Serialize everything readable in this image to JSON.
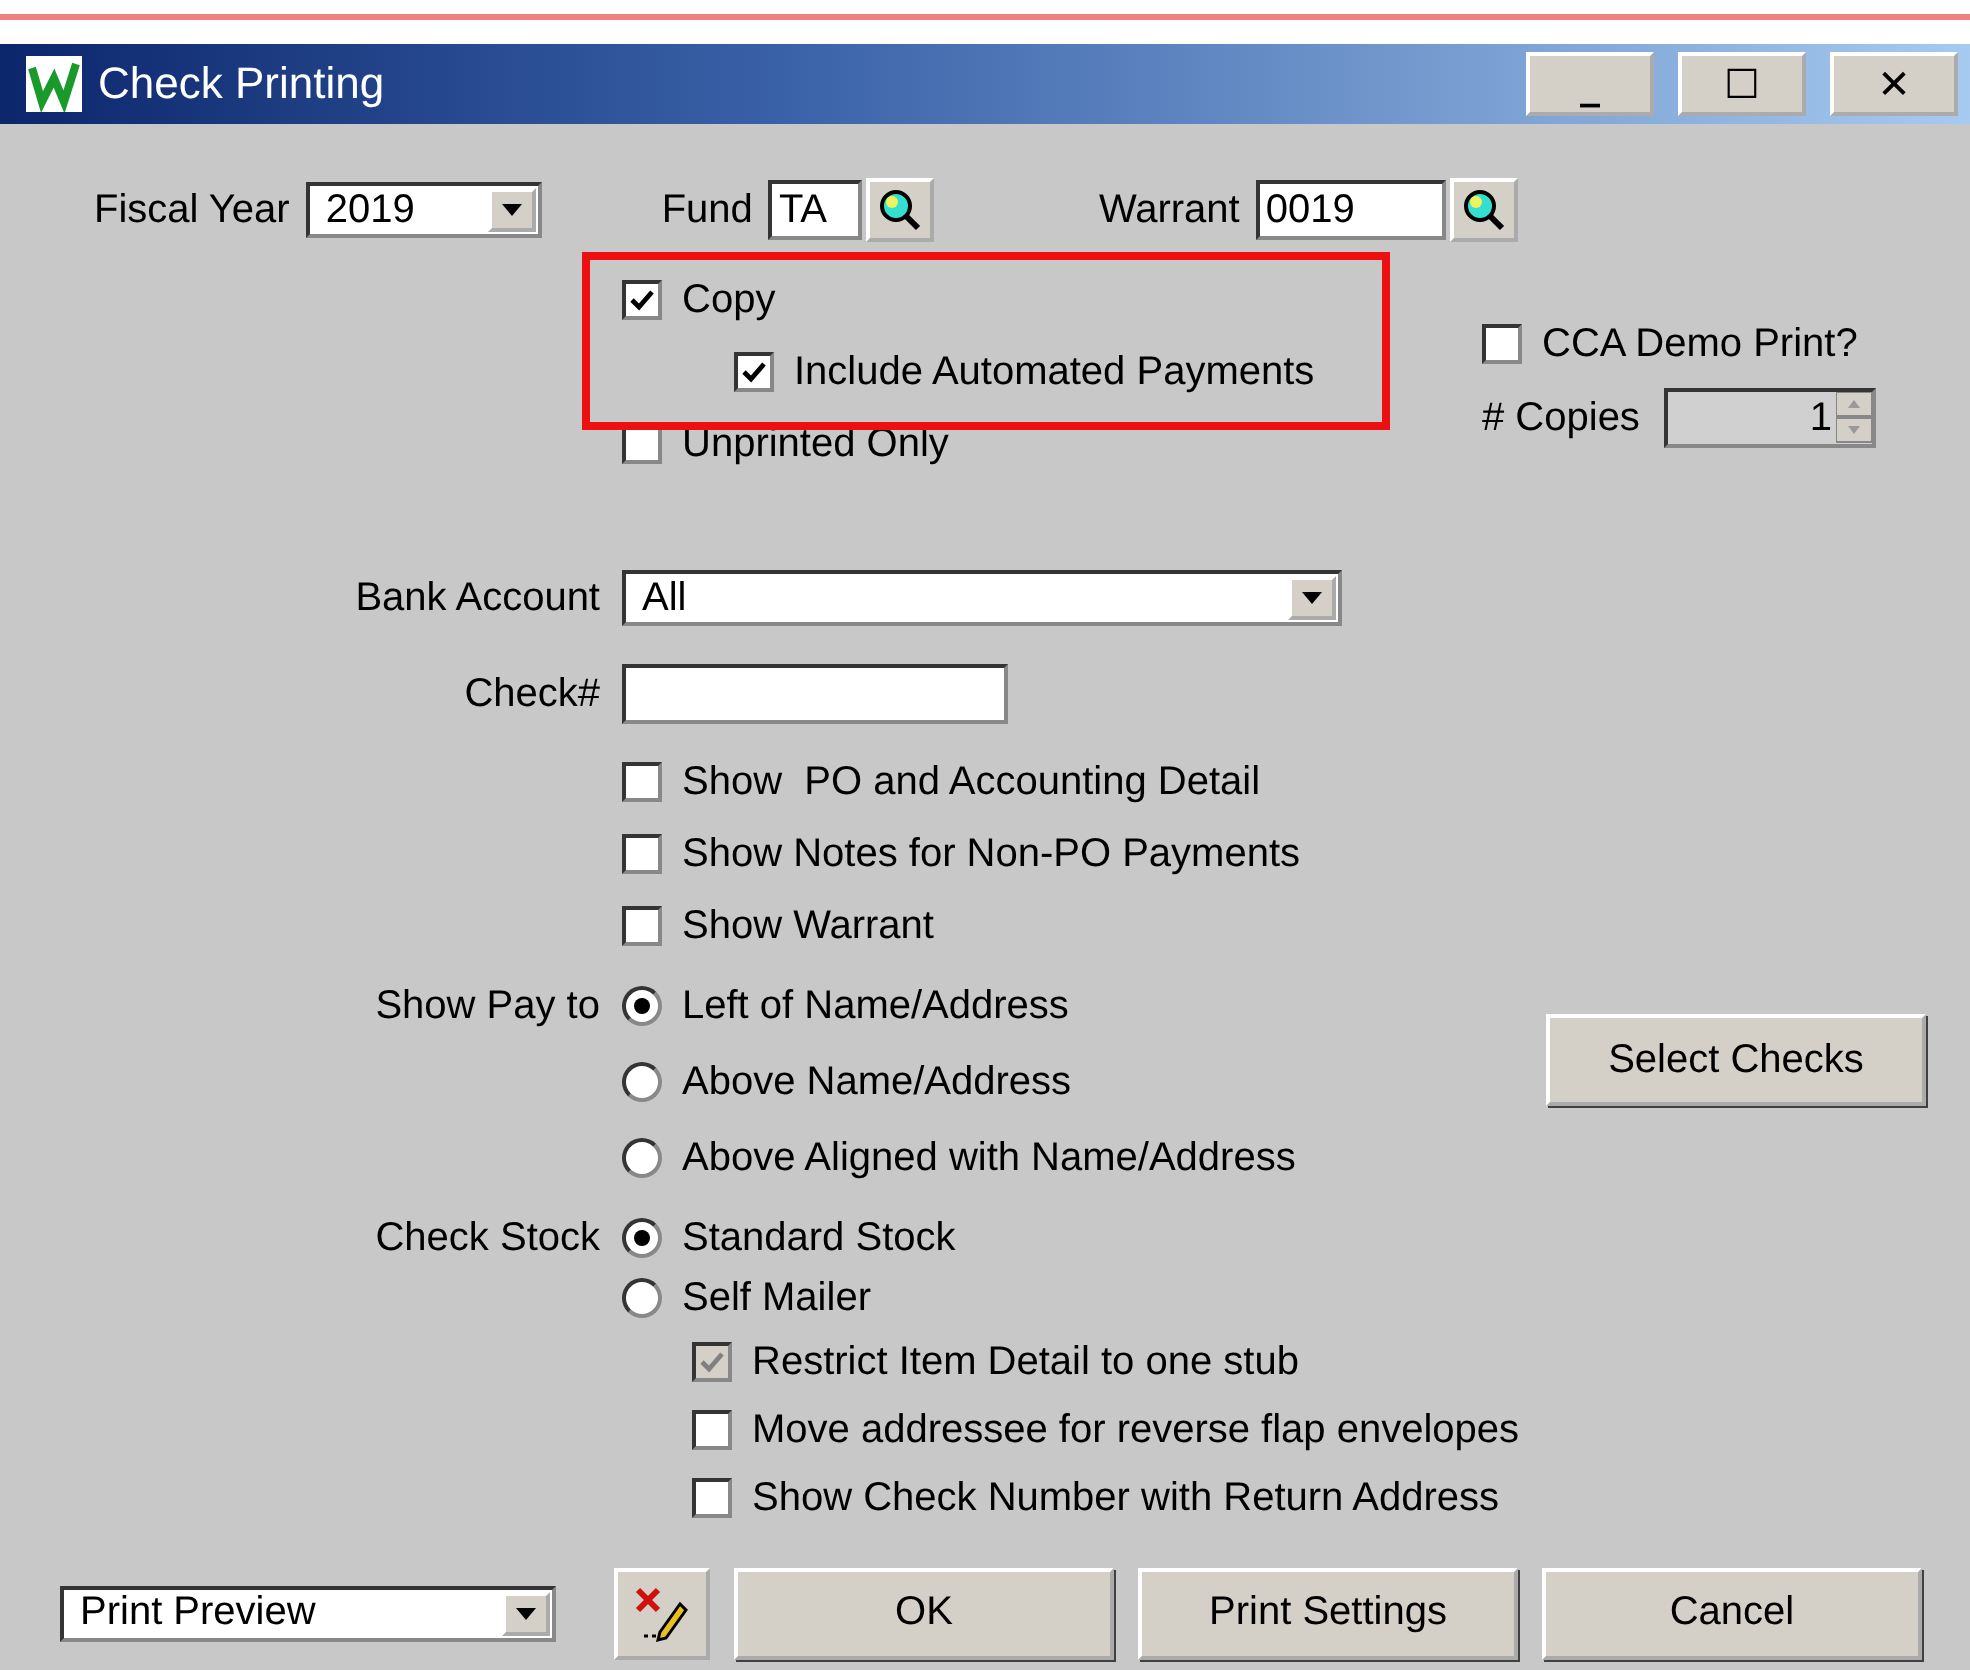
{
  "window": {
    "title": "Check Printing",
    "controls": [
      "_",
      "☐",
      "✕"
    ]
  },
  "fiscal_year": {
    "label": "Fiscal Year",
    "value": "2019"
  },
  "fund": {
    "label": "Fund",
    "value": "TA"
  },
  "warrant": {
    "label": "Warrant",
    "value": "0019"
  },
  "copy": {
    "label": "Copy",
    "checked": true
  },
  "include_automated": {
    "label": "Include Automated Payments",
    "checked": true
  },
  "unprinted_only": {
    "label": "Unprinted Only",
    "checked": false
  },
  "cca_demo": {
    "label": "CCA Demo Print?",
    "checked": false
  },
  "copies": {
    "label": "# Copies",
    "value": "1"
  },
  "bank_account": {
    "label": "Bank Account",
    "value": "All"
  },
  "check_number": {
    "label": "Check#"
  },
  "show_options": [
    {
      "label": "Show  PO and Accounting Detail",
      "checked": false
    },
    {
      "label": "Show Notes for Non-PO Payments",
      "checked": false
    },
    {
      "label": "Show Warrant",
      "checked": false
    }
  ],
  "show_pay_to": {
    "label": "Show Pay to",
    "options": [
      {
        "label": "Left of Name/Address",
        "selected": true
      },
      {
        "label": "Above Name/Address",
        "selected": false
      },
      {
        "label": "Above Aligned with Name/Address",
        "selected": false
      }
    ]
  },
  "select_checks": "Select Checks",
  "check_stock": {
    "label": "Check Stock",
    "options": [
      {
        "label": "Standard Stock",
        "selected": true
      },
      {
        "label": "Self Mailer",
        "selected": false
      }
    ]
  },
  "stub_options": [
    {
      "label": "Restrict Item Detail to one stub",
      "checked": true,
      "disabled": true
    },
    {
      "label": "Move addressee for reverse flap envelopes",
      "checked": false,
      "disabled": false
    },
    {
      "label": "Show Check Number with Return Address",
      "checked": false,
      "disabled": false
    }
  ],
  "output": {
    "value": "Print Preview"
  },
  "buttons": [
    "OK",
    "Print Settings",
    "Cancel"
  ]
}
